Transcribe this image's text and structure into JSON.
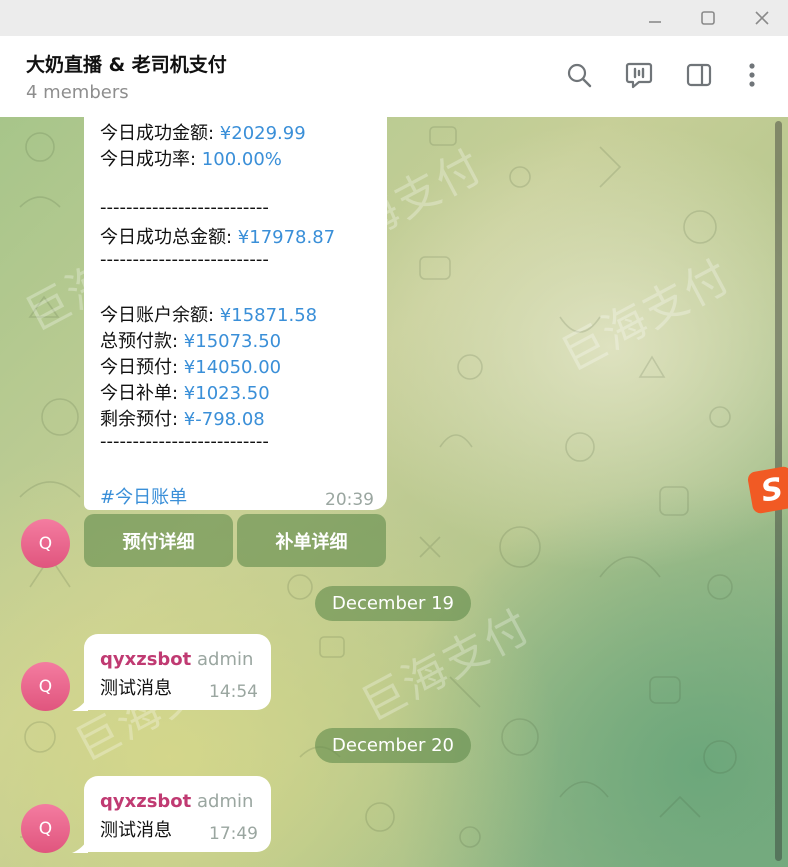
{
  "window": {
    "minimize_icon": "minimize-icon",
    "maximize_icon": "maximize-icon",
    "close_icon": "close-icon"
  },
  "header": {
    "title": "大奶直播 & 老司机支付",
    "subtitle": "4 members",
    "icons": [
      "search-icon",
      "live-chat-icon",
      "sidebar-toggle-icon",
      "more-vertical-icon"
    ]
  },
  "watermark": "巨海支付",
  "report": {
    "lines": [
      {
        "label": "今日成功金额: ",
        "value": "¥2029.99"
      },
      {
        "label": "今日成功率: ",
        "value": "100.00%"
      },
      {
        "label": "--------------------------",
        "value": ""
      },
      {
        "label": "今日成功总金额: ",
        "value": "¥17978.87"
      },
      {
        "label": "--------------------------",
        "value": ""
      },
      {
        "label": "今日账户余额: ",
        "value": "¥15871.58"
      },
      {
        "label": "总预付款: ",
        "value": "¥15073.50"
      },
      {
        "label": "今日预付: ",
        "value": "¥14050.00"
      },
      {
        "label": "今日补单: ",
        "value": "¥1023.50"
      },
      {
        "label": "剩余预付: ",
        "value": "¥-798.08"
      },
      {
        "label": "--------------------------",
        "value": ""
      }
    ],
    "hashtag": "#今日账单",
    "time": "20:39"
  },
  "keyboard": {
    "prepay_button": "预付详细",
    "supplement_button": "补单详细"
  },
  "avatar_letter": "Q",
  "dates": {
    "first": "December 19",
    "second": "December 20"
  },
  "messages": [
    {
      "sender": "qyxzsbot",
      "role": "admin",
      "text": "测试消息",
      "time": "14:54"
    },
    {
      "sender": "qyxzsbot",
      "role": "admin",
      "text": "测试消息",
      "time": "17:49"
    }
  ],
  "colors": {
    "link_blue": "#3a8fd8",
    "sender_pink": "#c03a72",
    "avatar_pink": "#e86a90",
    "accent_green": "#628c4e"
  }
}
